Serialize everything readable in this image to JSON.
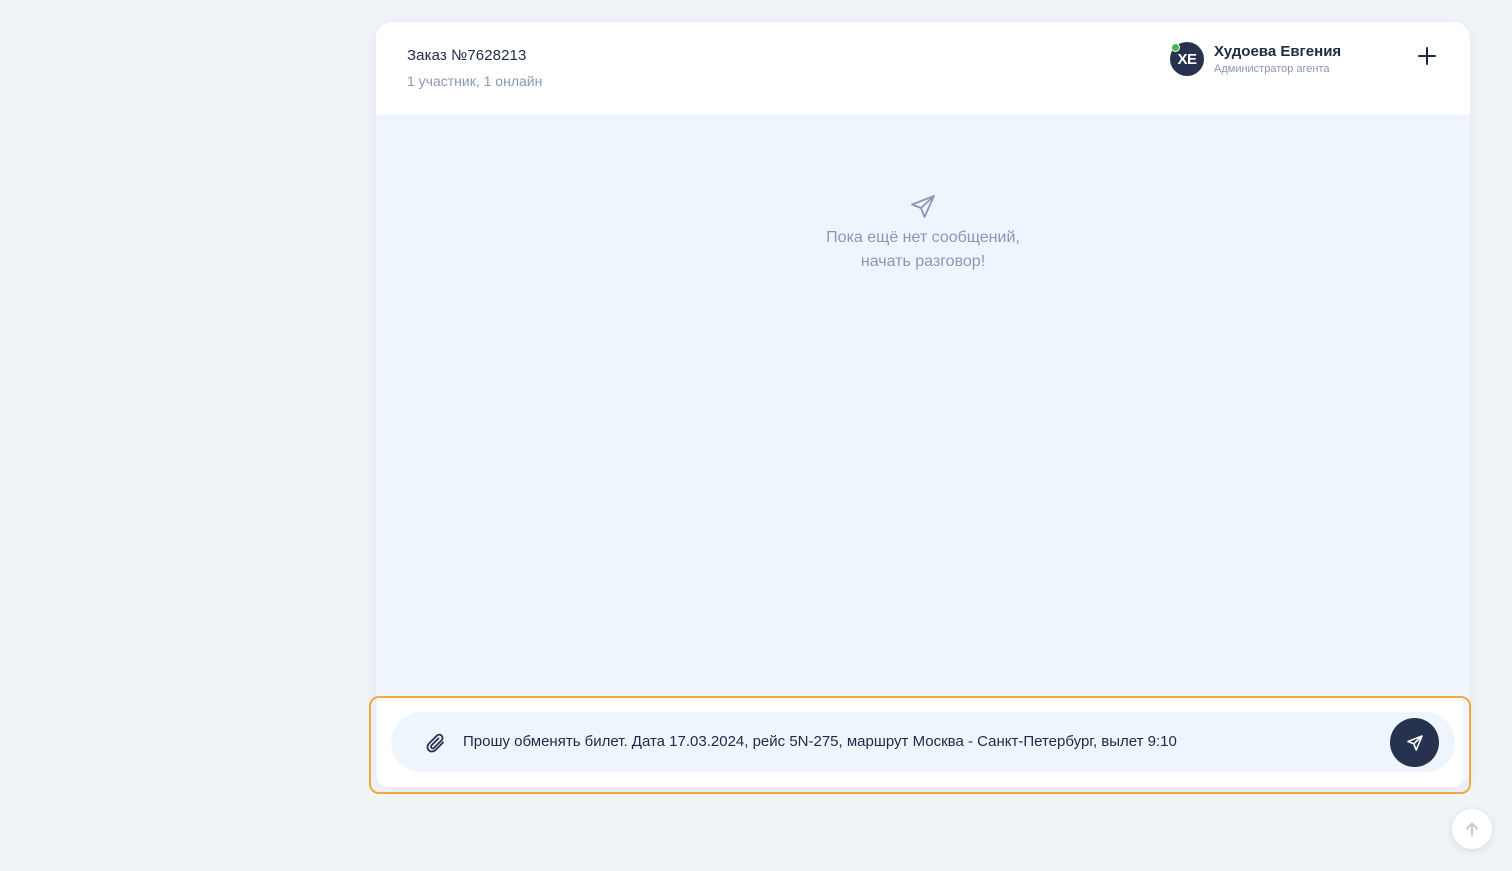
{
  "chat": {
    "order_title": "Заказ №7628213",
    "participants": "1 участник, 1 онлайн"
  },
  "user": {
    "initials": "ХЕ",
    "name": "Худоева Евгения",
    "role": "Администратор агента",
    "status_color": "#3fb950"
  },
  "empty_state": {
    "icon": "send-icon",
    "line1": "Пока ещё нет сообщений,",
    "line2": "начать разговор!"
  },
  "composer": {
    "message": "Прошу обменять билет. Дата 17.03.2024, рейс 5N-275, маршрут Москва - Санкт-Петербург, вылет 9:10",
    "attach_icon": "paperclip-icon",
    "send_icon": "send-icon"
  },
  "icons": {
    "add": "plus-icon",
    "scroll_top": "arrow-up-icon"
  },
  "colors": {
    "accent_dark": "#27324f",
    "highlight_border": "#f2a93b",
    "muted_text": "#8a98b5",
    "panel_bg": "#eef5fd"
  }
}
